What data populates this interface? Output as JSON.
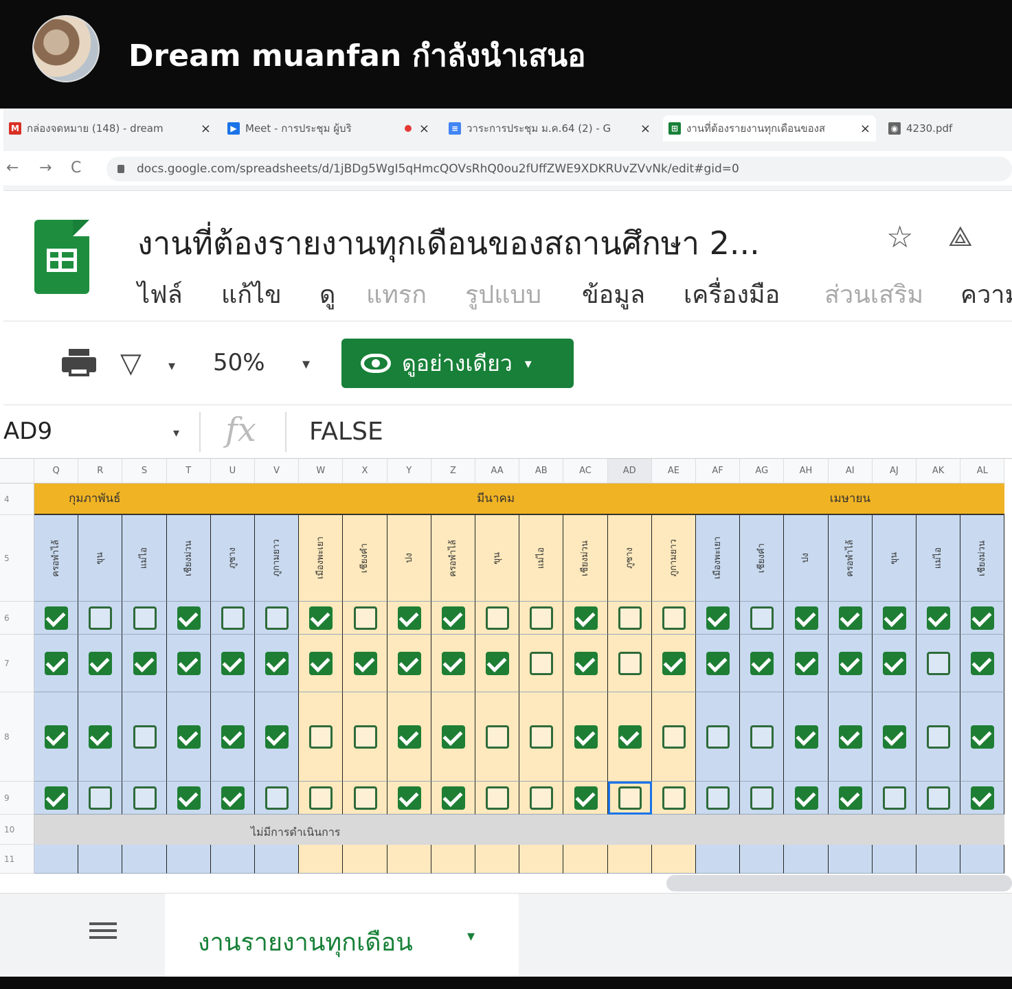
{
  "presenter": {
    "text": "Dream muanfan กำลังนำเสนอ"
  },
  "browser": {
    "tabs": [
      {
        "label": "กล่องจดหมาย (148) - dream",
        "icon": "gmail-icon",
        "color": "#d93025",
        "glyph": "M"
      },
      {
        "label": "Meet - การประชุม ผู้บริ",
        "icon": "meet-icon",
        "color": "#1a73e8",
        "glyph": "▶"
      },
      {
        "label": "วาระการประชุม ม.ค.64 (2) - G",
        "icon": "docs-icon",
        "color": "#4285f4",
        "glyph": "≡"
      },
      {
        "label": "งานที่ต้องรายงานทุกเดือนของส",
        "icon": "sheets-icon",
        "color": "#188038",
        "glyph": "⊞"
      },
      {
        "label": "4230.pdf",
        "icon": "globe-icon",
        "color": "#666",
        "glyph": "◉"
      }
    ],
    "url": "docs.google.com/spreadsheets/d/1jBDg5WgI5qHmcQOVsRhQ0ou2fUffZWE9XDKRUvZVvNk/edit#gid=0"
  },
  "doc": {
    "title": "งานที่ต้องรายงานทุกเดือนของสถานศึกษา 2...",
    "menu": [
      {
        "label": "ไฟล์",
        "color": "#333"
      },
      {
        "label": "แก้ไข",
        "color": "#333"
      },
      {
        "label": "ดู",
        "color": "#333"
      },
      {
        "label": "แทรก",
        "color": "#aaa"
      },
      {
        "label": "รูปแบบ",
        "color": "#aaa"
      },
      {
        "label": "ข้อมูล",
        "color": "#333"
      },
      {
        "label": "เครื่องมือ",
        "color": "#333"
      },
      {
        "label": "ส่วนเสริม",
        "color": "#aaa"
      },
      {
        "label": "ความ",
        "color": "#333"
      }
    ]
  },
  "toolbar": {
    "zoom": "50%",
    "view_only": "ดูอย่างเดียว"
  },
  "formula_bar": {
    "name_box": "AD9",
    "fx": "fx",
    "value": "FALSE"
  },
  "grid": {
    "columns": [
      "Q",
      "R",
      "S",
      "T",
      "U",
      "V",
      "W",
      "X",
      "Y",
      "Z",
      "AA",
      "AB",
      "AC",
      "AD",
      "AE",
      "AF",
      "AG",
      "AH",
      "AI",
      "AJ",
      "AK",
      "AL"
    ],
    "selected_column": "AD",
    "row_numbers": [
      "4",
      "5",
      "6",
      "7",
      "8",
      "9",
      "10",
      "11"
    ],
    "bands": [
      {
        "label": "กุมภาพันธ์",
        "start": 0,
        "span": 6
      },
      {
        "label": "มีนาคม",
        "start": 6,
        "span": 9
      },
      {
        "label": "เมษายน",
        "start": 15,
        "span": 7
      }
    ],
    "col_colors": [
      "blue",
      "blue",
      "blue",
      "blue",
      "blue",
      "blue",
      "cream",
      "cream",
      "cream",
      "cream",
      "cream",
      "cream",
      "cream",
      "cream",
      "cream",
      "blue",
      "blue",
      "blue",
      "blue",
      "blue",
      "blue",
      "blue"
    ],
    "headers": [
      "ครอพำไล้",
      "ขุน",
      "แม่ไอ",
      "เชียงม่วน",
      "ภูซาง",
      "ภูกามยาว",
      "เมืองพะเยา",
      "เชียงคำ",
      "ปง",
      "ครอพำไล้",
      "ขุน",
      "แม่ไอ",
      "เชียงม่วน",
      "ภูซาง",
      "ภูกามยาว",
      "เมืองพะเยา",
      "เชียงคำ",
      "ปง",
      "ครอพำไล้",
      "ขุน",
      "แม่ไอ",
      "เชียงม่วน"
    ],
    "checks": [
      [
        1,
        0,
        0,
        1,
        0,
        0,
        1,
        0,
        1,
        1,
        0,
        0,
        1,
        0,
        0,
        1,
        0,
        1,
        1,
        1,
        1,
        1
      ],
      [
        1,
        1,
        1,
        1,
        1,
        1,
        1,
        1,
        1,
        1,
        1,
        0,
        1,
        0,
        1,
        1,
        1,
        1,
        1,
        1,
        0,
        1
      ],
      [
        1,
        1,
        0,
        1,
        1,
        1,
        0,
        0,
        1,
        1,
        0,
        0,
        1,
        1,
        0,
        0,
        0,
        1,
        1,
        1,
        0,
        1
      ],
      [
        1,
        0,
        0,
        1,
        1,
        0,
        0,
        0,
        1,
        1,
        0,
        0,
        1,
        0,
        0,
        0,
        0,
        1,
        1,
        0,
        0,
        1
      ]
    ],
    "note": "ไม่มีการดำเนินการ"
  },
  "bottom": {
    "sheet_tab": "งานรายงานทุกเดือน"
  }
}
